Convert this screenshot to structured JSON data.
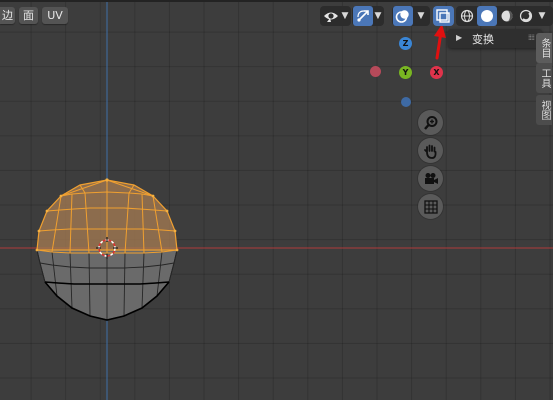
{
  "header": {
    "left_buttons": [
      {
        "label": "边"
      },
      {
        "label": "面"
      },
      {
        "label": "UV"
      }
    ],
    "icons": {
      "visibility": "eye-icon",
      "gizmo": "gizmo-arrows-icon",
      "overlay": "overlay-circles-icon",
      "xray": "xray-toggle-icon",
      "shading_wire": "wireframe-shading-icon",
      "shading_solid": "solid-shading-icon",
      "shading_material": "material-shading-icon",
      "shading_rendered": "rendered-shading-icon"
    },
    "accent_color": "#4b77b8"
  },
  "popup": {
    "transform_label": "变换",
    "arrow_color": "#e01010"
  },
  "sidebar": {
    "tabs": [
      {
        "label": "条目",
        "active": true
      },
      {
        "label": "工具",
        "active": false
      },
      {
        "label": "视图",
        "active": false
      }
    ]
  },
  "gizmo": {
    "axes": [
      {
        "label": "Z",
        "color": "#3a86d6"
      },
      {
        "label": "Y",
        "color": "#79b622"
      },
      {
        "label": "X",
        "color": "#e0334b"
      }
    ],
    "negative_axes": [
      {
        "axis": "-X",
        "color": "#b64a5a"
      },
      {
        "axis": "-Z",
        "color": "#3e6aa4"
      }
    ],
    "nav_buttons": [
      "zoom-icon",
      "pan-hand-icon",
      "camera-icon",
      "grid-icon"
    ]
  },
  "viewport": {
    "background": "#3d3d3d",
    "x_axis_color": "#b03a3a",
    "z_axis_color": "#3e6fa8",
    "selection_color": "#f0a030"
  }
}
